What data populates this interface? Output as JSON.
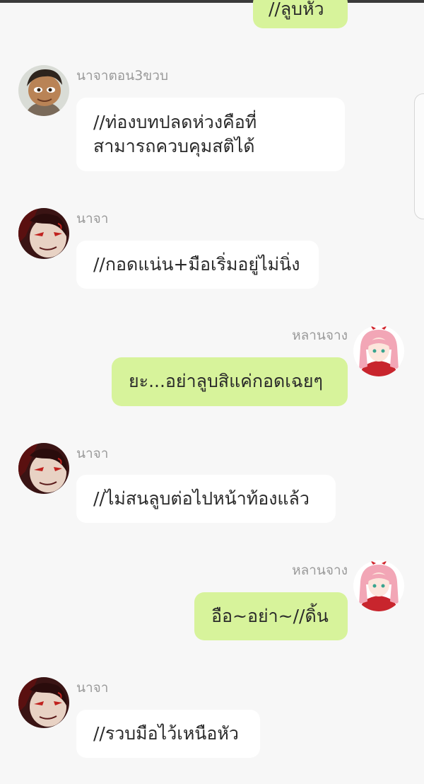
{
  "colors": {
    "background": "#f7f7f7",
    "incoming_bubble": "#ffffff",
    "outgoing_bubble": "#d7f39b",
    "name_text": "#9a9a9a",
    "message_text": "#2a2a2a"
  },
  "chat": {
    "messages": [
      {
        "sender": "",
        "direction": "outgoing",
        "avatar_icon": "",
        "lines": [
          "//ลูบหัว"
        ]
      },
      {
        "sender": "นาจาตอน3ขวบ",
        "direction": "incoming",
        "avatar_icon": "child-avatar-icon",
        "lines": [
          "//ท่องบทปลดห่วงคือที่",
          "สามารถควบคุมสติได้"
        ]
      },
      {
        "sender": "นาจา",
        "direction": "incoming",
        "avatar_icon": "demon-avatar-icon",
        "lines": [
          "//กอดแน่น+มือเริ่มอยู่ไม่นิ่ง"
        ]
      },
      {
        "sender": "หลานจาง",
        "direction": "outgoing",
        "avatar_icon": "pink-hair-girl-avatar-icon",
        "lines": [
          "ยะ...อย่าลูบสิแค่กอดเฉยๆ"
        ]
      },
      {
        "sender": "นาจา",
        "direction": "incoming",
        "avatar_icon": "demon-avatar-icon",
        "lines": [
          "//ไม่สนลูบต่อไปหน้าท้องแล้ว"
        ]
      },
      {
        "sender": "หลานจาง",
        "direction": "outgoing",
        "avatar_icon": "pink-hair-girl-avatar-icon",
        "lines": [
          "อือ~อย่า~//ดิ้น"
        ]
      },
      {
        "sender": "นาจา",
        "direction": "incoming",
        "avatar_icon": "demon-avatar-icon",
        "lines": [
          "//รวบมือไว้เหนือหัว"
        ]
      }
    ]
  }
}
